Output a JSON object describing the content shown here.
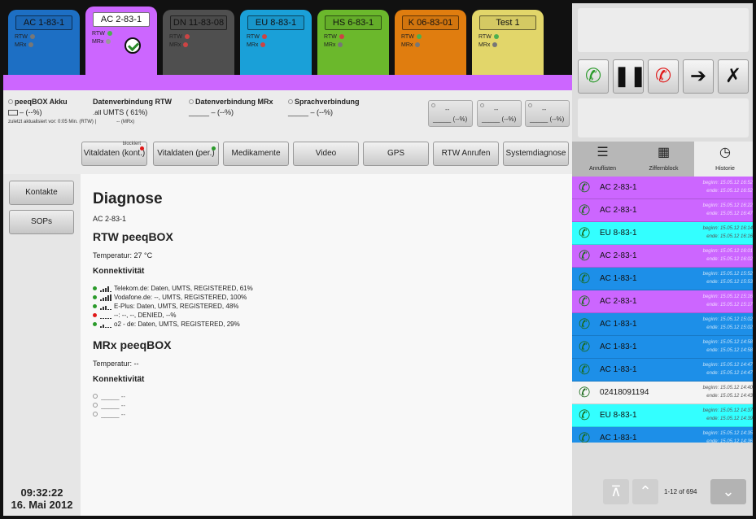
{
  "tabs": [
    {
      "label": "AC 1-83-1",
      "rtw": "RTW",
      "mrx": "MRx",
      "color": "#1d6fc4",
      "rtw_led": "#777",
      "mrx_led": "#777"
    },
    {
      "label": "AC 2-83-1",
      "rtw": "RTW",
      "mrx": "MRx",
      "color": "#cc66ff",
      "rtw_led": "#4caf50",
      "mrx_led": "#999"
    },
    {
      "label": "DN 11-83-08",
      "rtw": "RTW",
      "mrx": "MRx",
      "color": "#4f4f4f",
      "rtw_led": "#c44",
      "mrx_led": "#c44"
    },
    {
      "label": "EU 8-83-1",
      "rtw": "RTW",
      "mrx": "MRx",
      "color": "#1aa0d8",
      "rtw_led": "#c44",
      "mrx_led": "#c44"
    },
    {
      "label": "HS 6-83-1",
      "rtw": "RTW",
      "mrx": "MRx",
      "color": "#6bb82c",
      "rtw_led": "#c44",
      "mrx_led": "#777"
    },
    {
      "label": "K 06-83-01",
      "rtw": "RTW",
      "mrx": "MRx",
      "color": "#e07d0f",
      "rtw_led": "#4caf50",
      "mrx_led": "#777"
    },
    {
      "label": "Test 1",
      "rtw": "RTW",
      "mrx": "MRx",
      "color": "#e2d66a",
      "rtw_led": "#4caf50",
      "mrx_led": "#777"
    }
  ],
  "status": {
    "akku_title": "peeqBOX Akku",
    "akku_value": "– (--%)",
    "updated": "zuletzt aktualisiert vor:  0:05 Min. (RTW) |",
    "updated_mrx": "-- (MRx)",
    "rtw_title": "Datenverbindung RTW",
    "rtw_value": "UMTS ( 61%)",
    "mrx_title": "Datenverbindung MRx",
    "mrx_value": "– (--%)",
    "sprach_title": "Sprachverbindung",
    "sprach_value": "– (--%)",
    "box_top": "--",
    "box_value": "(--%)"
  },
  "nav": {
    "vital_kont": "Vitaldaten (kont.)",
    "vital_kont_tag": "blockiert",
    "vital_per": "Vitaldaten (per.)",
    "medikamente": "Medikamente",
    "video": "Video",
    "gps": "GPS",
    "rtw_anrufen": "RTW Anrufen",
    "systemdiagnose": "Systemdiagnose"
  },
  "sidebar": {
    "kontakte": "Kontakte",
    "sops": "SOPs",
    "time": "09:32:22",
    "date": "16. Mai 2012"
  },
  "main": {
    "title": "Diagnose",
    "subtitle": "AC 2-83-1",
    "rtw_heading": "RTW peeqBOX",
    "rtw_temp": "Temperatur:  27 °C",
    "konn": "Konnektivität",
    "rtw_conns": [
      {
        "text": "Telekom.de: Daten, UMTS, REGISTERED, 61%",
        "dot": "#2a9a2a",
        "bars": 4
      },
      {
        "text": "Vodafone.de: --, UMTS, REGISTERED, 100%",
        "dot": "#2a9a2a",
        "bars": 5
      },
      {
        "text": "E-Plus: Daten, UMTS, REGISTERED, 48%",
        "dot": "#2a9a2a",
        "bars": 3
      },
      {
        "text": "--: --, --, DENIED, --%",
        "dot": "#e01818",
        "bars": 0
      },
      {
        "text": "o2 - de: Daten, UMTS, REGISTERED, 29%",
        "dot": "#2a9a2a",
        "bars": 2
      }
    ],
    "mrx_heading": "MRx peeqBOX",
    "mrx_temp": "Temperatur:  --",
    "mrx_conns": [
      "--",
      "--",
      "--"
    ]
  },
  "right": {
    "tab_anruflisten": "Anruflisten",
    "tab_ziffernblock": "Ziffernblock",
    "tab_historie": "Historie",
    "calls": [
      {
        "name": "AC 2-83-1",
        "begin": "beginn: 15.05.12 16:52",
        "end": "ende: 15.05.12 16:52",
        "bg": "#cc66ff",
        "icon": "#1a6a1a"
      },
      {
        "name": "AC 2-83-1",
        "begin": "beginn: 15.05.12 16:22",
        "end": "ende: 15.05.12 16:47",
        "bg": "#cc66ff",
        "icon": "#1a6a1a"
      },
      {
        "name": "EU 8-83-1",
        "begin": "beginn: 15.05.12 16:14",
        "end": "ende: 15.05.12 16:16",
        "bg": "#33ffff",
        "icon": "#1a6a1a"
      },
      {
        "name": "AC 2-83-1",
        "begin": "beginn: 15.05.12 16:01",
        "end": "ende: 15.05.12 16:02",
        "bg": "#cc66ff",
        "icon": "#1a6a1a"
      },
      {
        "name": "AC 1-83-1",
        "begin": "beginn: 15.05.12 15:52",
        "end": "ende: 15.05.12 15:53",
        "bg": "#1d8fe8",
        "icon": "#1a6a1a"
      },
      {
        "name": "AC 2-83-1",
        "begin": "beginn: 15.05.12 15:16",
        "end": "ende: 15.05.12 15:17",
        "bg": "#cc66ff",
        "icon": "#1a6a1a"
      },
      {
        "name": "AC 1-83-1",
        "begin": "beginn: 15.05.12 15:02",
        "end": "ende: 15.05.12 15:02",
        "bg": "#1d8fe8",
        "icon": "#1a6a1a"
      },
      {
        "name": "AC 1-83-1",
        "begin": "beginn: 15.05.12 14:58",
        "end": "ende: 15.05.12 14:58",
        "bg": "#1d8fe8",
        "icon": "#1a6a1a"
      },
      {
        "name": "AC 1-83-1",
        "begin": "beginn: 15.05.12 14:47",
        "end": "ende: 15.05.12 14:47",
        "bg": "#1d8fe8",
        "icon": "#1a6a1a"
      },
      {
        "name": "02418091194",
        "begin": "beginn: 15.05.12 14:40",
        "end": "ende: 15.05.12 14:43",
        "bg": "#f4f4f4",
        "icon": "#1a6a1a"
      },
      {
        "name": "EU 8-83-1",
        "begin": "beginn: 15.05.12 14:37",
        "end": "ende: 15.05.12 14:39",
        "bg": "#33ffff",
        "icon": "#1a6a1a"
      },
      {
        "name": "AC 1-83-1",
        "begin": "beginn: 15.05.12 14:35",
        "end": "ende: 15.05.12 14:36",
        "bg": "#1d8fe8",
        "icon": "#1a6a1a"
      }
    ],
    "pager_text": "1-12 of 694"
  }
}
